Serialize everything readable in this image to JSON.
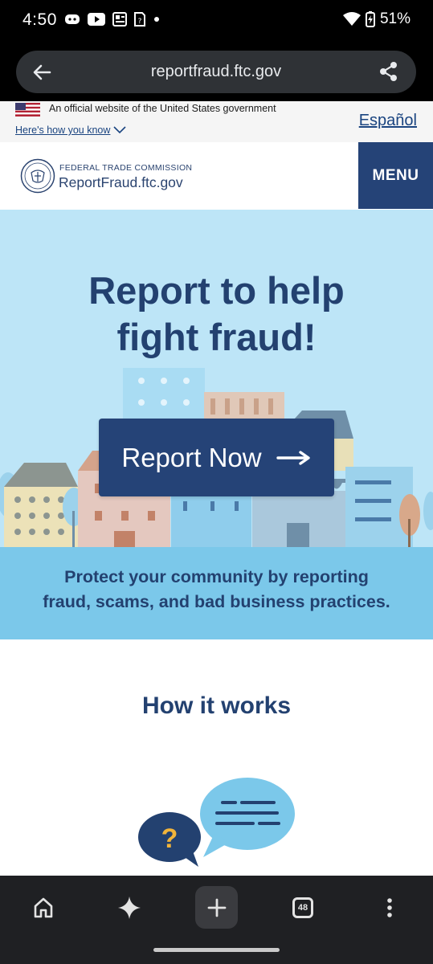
{
  "status_bar": {
    "time": "4:50",
    "battery": "51%",
    "icons": [
      "discord-icon",
      "youtube-icon",
      "news-icon",
      "sim-icon",
      "dot-icon",
      "wifi-icon",
      "battery-charging-icon"
    ]
  },
  "browser": {
    "url": "reportfraud.ftc.gov",
    "tab_count": "48",
    "icons": [
      "back-arrow-icon",
      "share-icon",
      "home-icon",
      "sparkle-icon",
      "plus-icon",
      "tabs-icon",
      "more-vert-icon"
    ]
  },
  "gov_banner": {
    "official_text": "An official website of the United States government",
    "how_you_know": "Here's how you know",
    "espanol": "Español"
  },
  "header": {
    "agency": "FEDERAL TRADE COMMISSION",
    "site_name": "ReportFraud.ftc.gov",
    "menu": "MENU"
  },
  "hero": {
    "title_line1": "Report to help",
    "title_line2": "fight fraud!",
    "button_label": "Report Now"
  },
  "protect": {
    "line1": "Protect your community by reporting",
    "line2": "fraud, scams, and bad business practices."
  },
  "how_it_works": {
    "heading": "How it works",
    "question_mark": "?"
  },
  "colors": {
    "navy": "#254377",
    "hero_bg": "#bde5f7",
    "band_bg": "#7bc8ea",
    "link": "#1a4480"
  }
}
